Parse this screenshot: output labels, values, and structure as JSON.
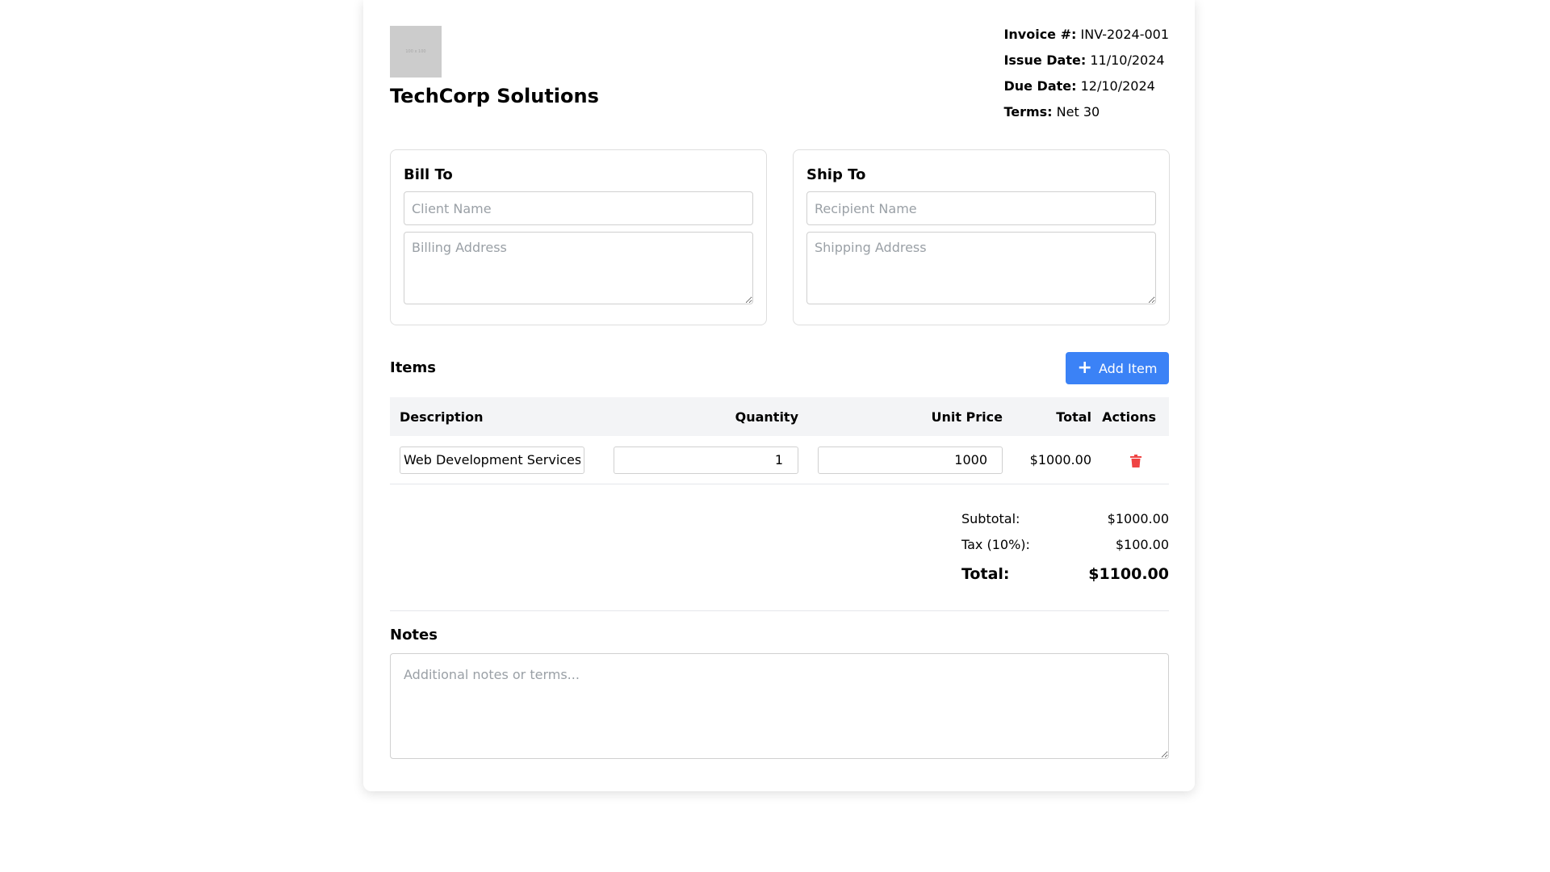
{
  "company": {
    "logo_text": "100 x 100",
    "name": "TechCorp Solutions"
  },
  "invoice_meta": {
    "invoice_number_label": "Invoice #:",
    "invoice_number": "INV-2024-001",
    "issue_date_label": "Issue Date:",
    "issue_date": "11/10/2024",
    "due_date_label": "Due Date:",
    "due_date": "12/10/2024",
    "terms_label": "Terms:",
    "terms": "Net 30"
  },
  "bill_to": {
    "title": "Bill To",
    "name_placeholder": "Client Name",
    "address_placeholder": "Billing Address"
  },
  "ship_to": {
    "title": "Ship To",
    "name_placeholder": "Recipient Name",
    "address_placeholder": "Shipping Address"
  },
  "items": {
    "title": "Items",
    "add_button_label": "Add Item",
    "columns": [
      "Description",
      "Quantity",
      "Unit Price",
      "Total",
      "Actions"
    ],
    "rows": [
      {
        "description": "Web Development Services",
        "quantity": "1",
        "unit_price": "1000",
        "total": "$1000.00"
      }
    ]
  },
  "totals": {
    "subtotal_label": "Subtotal:",
    "subtotal": "$1000.00",
    "tax_label": "Tax (10%):",
    "tax": "$100.00",
    "total_label": "Total:",
    "total": "$1100.00"
  },
  "notes": {
    "title": "Notes",
    "placeholder": "Additional notes or terms..."
  },
  "colors": {
    "accent": "#3b82f6",
    "delete": "#ef4444",
    "header_bg": "#f3f4f6"
  },
  "icons": {
    "add": "plus-icon",
    "delete": "trash-icon"
  }
}
